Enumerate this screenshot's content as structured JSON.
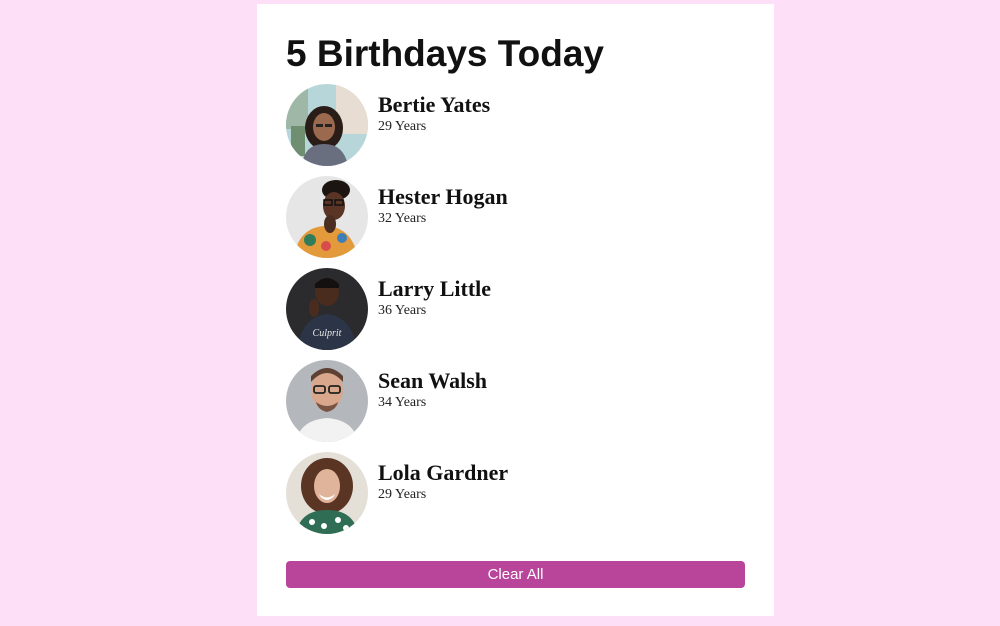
{
  "header": {
    "title": "5 Birthdays Today"
  },
  "people": [
    {
      "name": "Bertie Yates",
      "age": "29 Years",
      "photo": "woman-street-portrait"
    },
    {
      "name": "Hester Hogan",
      "age": "32 Years",
      "photo": "woman-glasses-portrait"
    },
    {
      "name": "Larry Little",
      "age": "36 Years",
      "photo": "man-dark-background-portrait"
    },
    {
      "name": "Sean Walsh",
      "age": "34 Years",
      "photo": "man-glasses-portrait"
    },
    {
      "name": "Lola Gardner",
      "age": "29 Years",
      "photo": "woman-curly-hair-portrait"
    }
  ],
  "actions": {
    "clear_label": "Clear All"
  },
  "colors": {
    "page_background": "#fde0f7",
    "card_background": "#ffffff",
    "button_background": "#b9459b",
    "button_text": "#ffffff"
  }
}
